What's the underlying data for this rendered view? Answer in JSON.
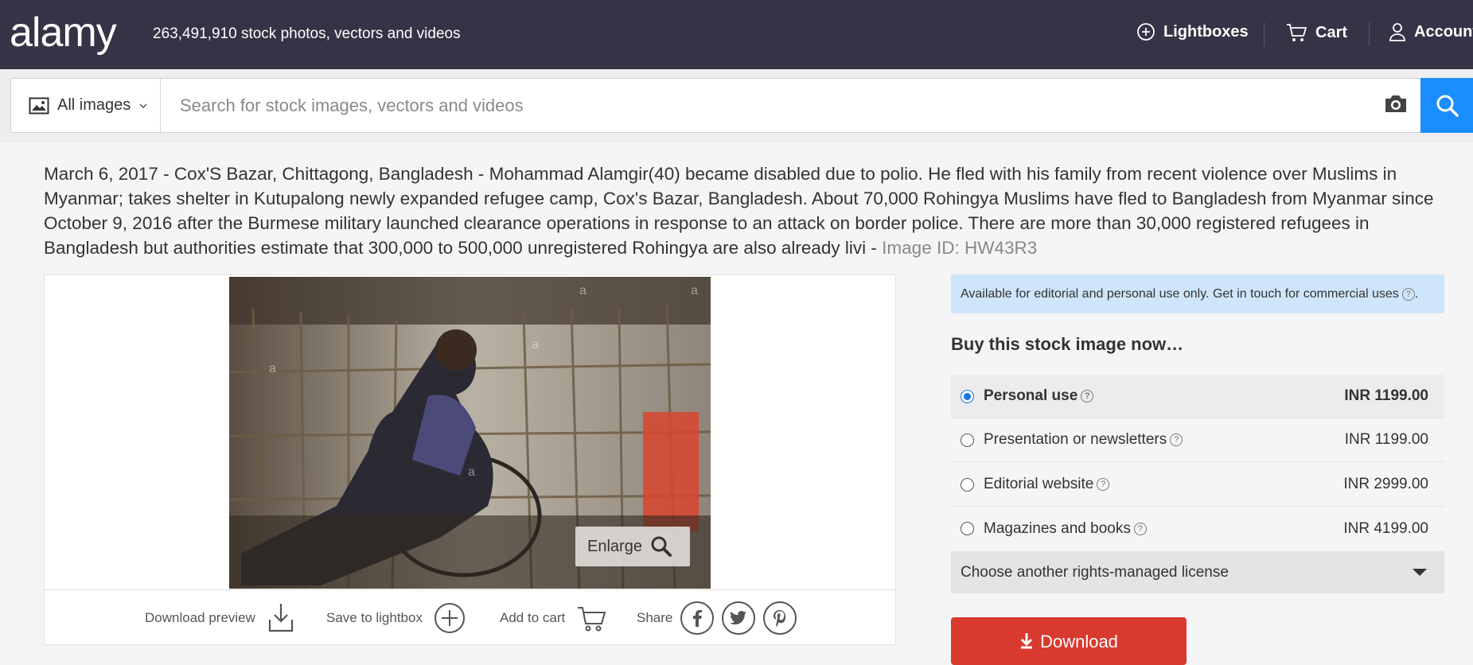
{
  "header": {
    "logo": "alamy",
    "tagline": "263,491,910 stock photos, vectors and videos",
    "lightboxes": "Lightboxes",
    "cart": "Cart",
    "account": "Account"
  },
  "search": {
    "filter_label": "All images",
    "placeholder": "Search for stock images, vectors and videos"
  },
  "description": {
    "text": "March 6, 2017 - Cox'S Bazar, Chittagong, Bangladesh - Mohammad Alamgir(40) became disabled due to polio. He fled with his family from recent violence over Muslims in Myanmar; takes shelter in Kutupalong newly expanded refugee camp, Cox's Bazar, Bangladesh. About 70,000 Rohingya Muslims have fled to Bangladesh from Myanmar since October 9, 2016 after the Burmese military launched clearance operations in response to an attack on border police. There are more than 30,000 registered refugees in Bangladesh but authorities estimate that 300,000 to 500,000 unregistered Rohingya are also already livi - ",
    "image_id": "Image ID: HW43R3"
  },
  "image": {
    "enlarge": "Enlarge",
    "watermark": "a"
  },
  "actions": {
    "download_preview": "Download preview",
    "save_lightbox": "Save to lightbox",
    "add_cart": "Add to cart",
    "share": "Share"
  },
  "purchase": {
    "notice": "Available for editorial and personal use only. Get in touch for commercial uses",
    "title": "Buy this stock image now…",
    "options": [
      {
        "label": "Personal use",
        "price": "INR 1199.00",
        "selected": true
      },
      {
        "label": "Presentation or newsletters",
        "price": "INR 1199.00",
        "selected": false
      },
      {
        "label": "Editorial website",
        "price": "INR 2999.00",
        "selected": false
      },
      {
        "label": "Magazines and books",
        "price": "INR 4199.00",
        "selected": false
      }
    ],
    "license_select": "Choose another rights-managed license",
    "download": "Download"
  },
  "colors": {
    "header_bg": "#343446",
    "search_button": "#1a8dff",
    "download_button": "#d93a2f",
    "notice_bg": "#cfe5fb"
  }
}
